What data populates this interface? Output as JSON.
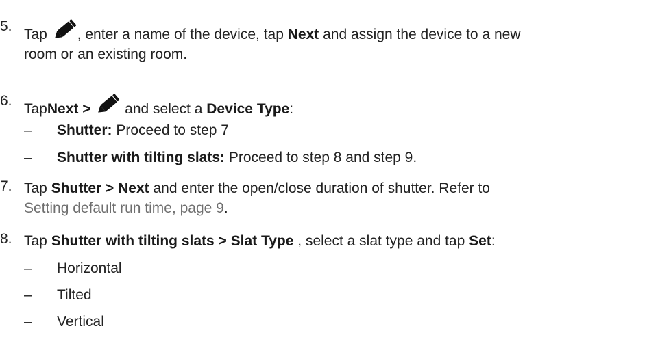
{
  "steps": {
    "s5": {
      "num": "5.",
      "p1": "Tap",
      "p2": ", enter a name of the device, tap",
      "b1": "Next",
      "p3": "and assign the device to a new",
      "line2": "room or an existing room."
    },
    "s6": {
      "num": "6.",
      "p1": "Tap",
      "b1": "Next >",
      "p2": "and select a",
      "b2": "Device Type",
      "p3": ":",
      "items": [
        {
          "bold": "Shutter:",
          "text": "Proceed to step 7"
        },
        {
          "bold": "Shutter with tilting slats:",
          "text": "Proceed to step 8 and step 9."
        }
      ]
    },
    "s7": {
      "num": "7.",
      "p1": "Tap",
      "b1": "Shutter > Next",
      "p2": "and enter the open/close duration of shutter. Refer to",
      "link": "Setting default run time, page 9",
      "p3": "."
    },
    "s8": {
      "num": "8.",
      "p1": "Tap",
      "b1": "Shutter with tilting slats > Slat Type",
      "p2": ", select a slat type and tap",
      "b2": "Set",
      "p3": ":",
      "items": [
        "Horizontal",
        "Tilted",
        "Vertical"
      ]
    }
  },
  "icons": {
    "edit": "pencil-icon"
  },
  "colors": {
    "text": "#222222",
    "link": "#6f6f6f"
  }
}
